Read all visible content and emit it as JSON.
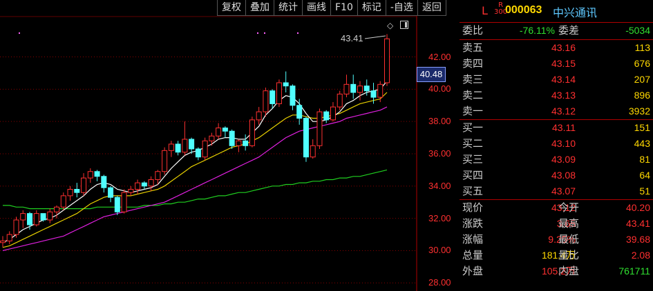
{
  "toolbar": [
    "复权",
    "叠加",
    "统计",
    "画线",
    "F10",
    "标记",
    "-自选",
    "返回"
  ],
  "chart": {
    "price_min": 27.5,
    "price_max": 44.5,
    "y_ticks": [
      "42.00",
      "40.00",
      "38.00",
      "36.00",
      "34.00",
      "32.00",
      "30.00",
      "28.00"
    ],
    "y_tick_values": [
      42,
      40,
      38,
      36,
      34,
      32,
      30,
      28
    ],
    "current_price_label": "40.48",
    "current_price_value": 40.48,
    "peak_label": "43.41",
    "candles": [
      [
        30.5,
        30.9,
        30.2,
        30.6
      ],
      [
        30.6,
        31.2,
        30.4,
        31.0
      ],
      [
        31.0,
        32.1,
        30.8,
        31.9
      ],
      [
        31.9,
        32.5,
        31.4,
        32.3
      ],
      [
        32.3,
        32.4,
        31.3,
        31.6
      ],
      [
        31.6,
        32.5,
        31.5,
        32.3
      ],
      [
        32.3,
        32.2,
        31.8,
        31.9
      ],
      [
        31.9,
        32.6,
        31.7,
        32.4
      ],
      [
        32.4,
        32.8,
        32.0,
        32.7
      ],
      [
        32.7,
        33.6,
        32.5,
        33.4
      ],
      [
        33.4,
        34.0,
        33.1,
        33.8
      ],
      [
        33.8,
        34.2,
        33.3,
        33.6
      ],
      [
        33.6,
        34.8,
        33.4,
        34.5
      ],
      [
        34.5,
        35.1,
        34.2,
        34.9
      ],
      [
        34.9,
        35.0,
        34.3,
        34.6
      ],
      [
        34.6,
        34.7,
        33.6,
        33.9
      ],
      [
        33.9,
        34.0,
        33.0,
        33.3
      ],
      [
        33.3,
        33.4,
        32.2,
        32.4
      ],
      [
        32.4,
        33.8,
        32.3,
        33.6
      ],
      [
        33.6,
        34.0,
        33.4,
        33.8
      ],
      [
        33.8,
        34.4,
        33.5,
        34.2
      ],
      [
        34.2,
        34.3,
        33.8,
        34.0
      ],
      [
        34.0,
        34.6,
        33.7,
        34.4
      ],
      [
        34.4,
        35.0,
        34.1,
        34.9
      ],
      [
        34.9,
        36.4,
        34.7,
        36.2
      ],
      [
        36.2,
        36.8,
        35.8,
        36.6
      ],
      [
        36.6,
        36.8,
        35.9,
        36.1
      ],
      [
        36.1,
        38.0,
        35.9,
        36.9
      ],
      [
        36.9,
        37.0,
        36.0,
        36.3
      ],
      [
        36.3,
        36.4,
        35.6,
        35.8
      ],
      [
        35.8,
        37.0,
        35.6,
        36.8
      ],
      [
        36.8,
        37.3,
        36.5,
        37.1
      ],
      [
        37.1,
        37.9,
        36.9,
        37.6
      ],
      [
        37.6,
        37.7,
        37.0,
        37.4
      ],
      [
        37.4,
        37.5,
        36.3,
        36.5
      ],
      [
        36.5,
        36.9,
        36.1,
        36.8
      ],
      [
        36.8,
        37.2,
        36.2,
        36.5
      ],
      [
        36.5,
        38.3,
        36.4,
        38.1
      ],
      [
        38.1,
        38.9,
        37.8,
        38.6
      ],
      [
        38.6,
        40.1,
        38.3,
        39.9
      ],
      [
        39.9,
        40.0,
        38.8,
        39.1
      ],
      [
        39.1,
        40.6,
        38.9,
        40.4
      ],
      [
        40.4,
        41.1,
        39.8,
        40.2
      ],
      [
        40.2,
        40.3,
        38.7,
        39.0
      ],
      [
        39.0,
        39.4,
        37.8,
        38.2
      ],
      [
        38.2,
        38.3,
        35.5,
        35.8
      ],
      [
        35.8,
        36.9,
        35.7,
        36.5
      ],
      [
        36.5,
        38.8,
        36.3,
        38.6
      ],
      [
        38.6,
        38.7,
        37.9,
        38.1
      ],
      [
        38.1,
        39.2,
        38.0,
        38.9
      ],
      [
        38.9,
        39.9,
        38.7,
        39.7
      ],
      [
        39.7,
        40.9,
        39.5,
        40.3
      ],
      [
        40.3,
        40.9,
        39.4,
        39.8
      ],
      [
        39.8,
        40.5,
        39.3,
        40.2
      ],
      [
        40.2,
        40.6,
        39.6,
        39.9
      ],
      [
        39.9,
        40.4,
        39.1,
        39.5
      ],
      [
        39.5,
        40.5,
        39.2,
        40.3
      ],
      [
        40.4,
        43.41,
        40.2,
        43.12
      ]
    ],
    "ma_white": [
      30.5,
      30.7,
      31.0,
      31.3,
      31.5,
      31.7,
      31.9,
      32.0,
      32.2,
      32.5,
      32.8,
      33.1,
      33.4,
      33.8,
      34.1,
      34.2,
      34.1,
      33.8,
      33.7,
      33.6,
      33.7,
      33.8,
      33.9,
      34.1,
      34.6,
      35.1,
      35.5,
      35.9,
      36.1,
      36.2,
      36.4,
      36.6,
      36.9,
      37.0,
      37.0,
      36.9,
      36.9,
      37.3,
      37.7,
      38.4,
      38.8,
      39.3,
      39.6,
      39.5,
      39.1,
      38.5,
      38.0,
      38.0,
      38.1,
      38.3,
      38.6,
      39.1,
      39.3,
      39.6,
      39.8,
      39.9,
      40.0,
      40.5
    ],
    "ma_yellow": [
      30.2,
      30.3,
      30.5,
      30.7,
      30.9,
      31.1,
      31.3,
      31.5,
      31.7,
      31.9,
      32.1,
      32.3,
      32.6,
      32.9,
      33.1,
      33.3,
      33.4,
      33.4,
      33.4,
      33.4,
      33.5,
      33.6,
      33.7,
      33.8,
      34.0,
      34.3,
      34.6,
      34.9,
      35.2,
      35.4,
      35.6,
      35.8,
      36.0,
      36.2,
      36.4,
      36.5,
      36.6,
      36.8,
      37.0,
      37.3,
      37.6,
      37.9,
      38.2,
      38.4,
      38.4,
      38.3,
      38.2,
      38.2,
      38.3,
      38.4,
      38.5,
      38.7,
      38.9,
      39.1,
      39.2,
      39.3,
      39.4,
      39.8
    ],
    "ma_magenta": [
      30.0,
      30.1,
      30.2,
      30.3,
      30.4,
      30.5,
      30.6,
      30.7,
      30.8,
      30.9,
      31.1,
      31.3,
      31.5,
      31.7,
      31.9,
      32.1,
      32.2,
      32.3,
      32.4,
      32.5,
      32.6,
      32.7,
      32.8,
      32.9,
      33.0,
      33.2,
      33.4,
      33.6,
      33.8,
      34.0,
      34.2,
      34.4,
      34.6,
      34.8,
      35.0,
      35.2,
      35.4,
      35.6,
      35.8,
      36.1,
      36.4,
      36.7,
      37.0,
      37.2,
      37.4,
      37.5,
      37.6,
      37.7,
      37.8,
      37.9,
      38.0,
      38.2,
      38.3,
      38.4,
      38.5,
      38.6,
      38.7,
      38.9
    ],
    "ma_green": [
      32.8,
      32.8,
      32.7,
      32.7,
      32.6,
      32.6,
      32.6,
      32.6,
      32.6,
      32.6,
      32.6,
      32.6,
      32.6,
      32.6,
      32.7,
      32.7,
      32.7,
      32.7,
      32.7,
      32.7,
      32.7,
      32.8,
      32.8,
      32.8,
      32.9,
      32.9,
      33.0,
      33.0,
      33.1,
      33.2,
      33.2,
      33.3,
      33.4,
      33.4,
      33.5,
      33.6,
      33.6,
      33.7,
      33.8,
      33.9,
      34.0,
      34.0,
      34.1,
      34.1,
      34.2,
      34.2,
      34.3,
      34.3,
      34.4,
      34.4,
      34.5,
      34.5,
      34.6,
      34.6,
      34.7,
      34.8,
      34.9,
      35.0
    ],
    "colors": {
      "up": "#ff3030",
      "down": "#50ffff",
      "white": "#ffffff",
      "yellow": "#e8d000",
      "magenta": "#e020e0",
      "green": "#20d020",
      "grid": "#8b0000"
    }
  },
  "quote": {
    "L": "L",
    "R_top": "R",
    "R_bottom": "300",
    "code": "000063",
    "name": "中兴通讯",
    "weibi_label": "委比",
    "weibi": "-76.11%",
    "weicha_label": "委差",
    "weicha": "-5034",
    "sell": [
      {
        "label": "卖五",
        "price": "43.16",
        "vol": "113"
      },
      {
        "label": "卖四",
        "price": "43.15",
        "vol": "676"
      },
      {
        "label": "卖三",
        "price": "43.14",
        "vol": "207"
      },
      {
        "label": "卖二",
        "price": "43.13",
        "vol": "896"
      },
      {
        "label": "卖一",
        "price": "43.12",
        "vol": "3932"
      }
    ],
    "buy": [
      {
        "label": "买一",
        "price": "43.11",
        "vol": "151"
      },
      {
        "label": "买二",
        "price": "43.10",
        "vol": "443"
      },
      {
        "label": "买三",
        "price": "43.09",
        "vol": "81"
      },
      {
        "label": "买四",
        "price": "43.08",
        "vol": "64"
      },
      {
        "label": "买五",
        "price": "43.07",
        "vol": "51"
      }
    ],
    "stats": [
      {
        "l1": "现价",
        "v1": "43.12",
        "c1": "red",
        "l2": "今开",
        "v2": "40.20",
        "c2": "red"
      },
      {
        "l1": "涨跌",
        "v1": "3.65",
        "c1": "red",
        "l2": "最高",
        "v2": "43.41",
        "c2": "red"
      },
      {
        "l1": "涨幅",
        "v1": "9.25%",
        "c1": "red",
        "l2": "最低",
        "v2": "39.68",
        "c2": "red"
      },
      {
        "l1": "总量",
        "v1": "181.4万",
        "c1": "yel",
        "l2": "量比",
        "v2": "2.08",
        "c2": "red"
      },
      {
        "l1": "外盘",
        "v1": "105.2万",
        "c1": "red",
        "l2": "内盘",
        "v2": "761711",
        "c2": "green"
      }
    ]
  }
}
